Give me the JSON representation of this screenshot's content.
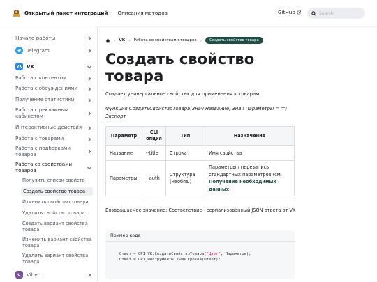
{
  "navbar": {
    "title": "Открытый пакет интеграций",
    "methods_link": "Описания методов",
    "github": "GitHub",
    "search_placeholder": "Search"
  },
  "sidebar": {
    "start": "Начало работы",
    "telegram": "Telegram",
    "vk": "VK",
    "vk_items": [
      "Работа с контентом",
      "Работа с обсуждениями",
      "Получение статистики",
      "Работа с рекламным кабинетом",
      "Интерактивные действия",
      "Работа с товарами",
      "Работа с подборками товаров",
      "Работа со свойствами товаров"
    ],
    "props_items": [
      "Получить список свойств",
      "Создать свойство товара",
      "Изменить свойство товара",
      "Удалить свойство товара",
      "Создать вариант свойства товара",
      "Изменить вариант свойства товара",
      "Удалить вариант свойства товара"
    ],
    "viber": "Viber"
  },
  "breadcrumb": {
    "level1": "VK",
    "level2": "Работа со свойствами товаров",
    "current": "Создать свойство товара"
  },
  "page": {
    "title": "Создать свойство товара",
    "description": "Создает универсальное свойство для применения к товарам",
    "function_signature": "Функция СоздатьСвойствоТовара(Знач Название, Знач Параметры = \"\") Экспорт",
    "table": {
      "headers": [
        "Параметр",
        "CLI опция",
        "Тип",
        "Назначение"
      ],
      "rows": [
        {
          "name": "Название",
          "cli": "--title",
          "type": "Строка",
          "purpose": "Имя свойства",
          "link": ""
        },
        {
          "name": "Параметры",
          "cli": "--auth",
          "type": "Структура (необяз.)",
          "purpose": "Параметры / перезапись стандартных параметров (см.",
          "link": "Получение необходимых данных",
          "tail": ")"
        }
      ]
    },
    "return_value": "Возвращаемое значение: Соответствие - сериализованный JSON ответа от VK",
    "code": {
      "header": "Пример кода",
      "line1_a": "Ответ = OPI_VK.СоздатьСвойствоТовара(",
      "line1_str": "\"Цвет\"",
      "line1_b": ", Параметры);",
      "line2": "Ответ = OPI_Инструменты.JSONСтрокой(Ответ);"
    }
  },
  "colors": {
    "accent": "#1f4e45",
    "telegram": "#2aa3df",
    "vk": "#2787f5",
    "viber": "#7b519d"
  }
}
